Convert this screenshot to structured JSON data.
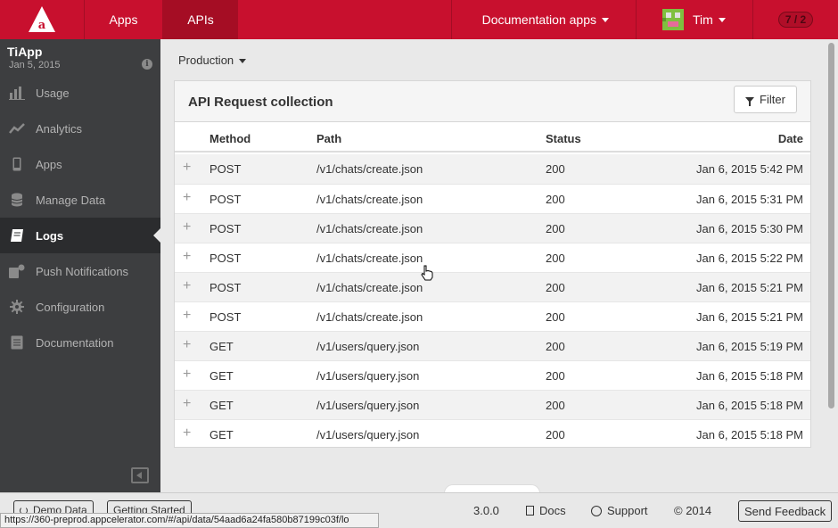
{
  "topnav": {
    "tabs": [
      {
        "label": "Apps"
      },
      {
        "label": "APIs"
      }
    ],
    "docs_dropdown": "Documentation apps",
    "user_name": "Tim",
    "badge": "7 / 2"
  },
  "sidebar": {
    "app_title": "TiApp",
    "app_date": "Jan 5, 2015",
    "items": [
      {
        "label": "Usage",
        "icon": "bar-chart-icon"
      },
      {
        "label": "Analytics",
        "icon": "line-chart-icon"
      },
      {
        "label": "Apps",
        "icon": "mobile-icon"
      },
      {
        "label": "Manage Data",
        "icon": "database-icon"
      },
      {
        "label": "Logs",
        "icon": "book-icon",
        "active": true
      },
      {
        "label": "Push Notifications",
        "icon": "push-icon"
      },
      {
        "label": "Configuration",
        "icon": "gear-icon"
      },
      {
        "label": "Documentation",
        "icon": "doc-icon"
      }
    ]
  },
  "main": {
    "environment": "Production",
    "panel_title": "API Request collection",
    "filter_label": "Filter",
    "columns": {
      "method": "Method",
      "path": "Path",
      "status": "Status",
      "date": "Date"
    },
    "rows": [
      {
        "method": "POST",
        "path": "/v1/chats/create.json",
        "status": "200",
        "date": "Jan 6, 2015 5:42 PM"
      },
      {
        "method": "POST",
        "path": "/v1/chats/create.json",
        "status": "200",
        "date": "Jan 6, 2015 5:31 PM"
      },
      {
        "method": "POST",
        "path": "/v1/chats/create.json",
        "status": "200",
        "date": "Jan 6, 2015 5:30 PM"
      },
      {
        "method": "POST",
        "path": "/v1/chats/create.json",
        "status": "200",
        "date": "Jan 6, 2015 5:22 PM"
      },
      {
        "method": "POST",
        "path": "/v1/chats/create.json",
        "status": "200",
        "date": "Jan 6, 2015 5:21 PM"
      },
      {
        "method": "POST",
        "path": "/v1/chats/create.json",
        "status": "200",
        "date": "Jan 6, 2015 5:21 PM"
      },
      {
        "method": "GET",
        "path": "/v1/users/query.json",
        "status": "200",
        "date": "Jan 6, 2015 5:19 PM"
      },
      {
        "method": "GET",
        "path": "/v1/users/query.json",
        "status": "200",
        "date": "Jan 6, 2015 5:18 PM"
      },
      {
        "method": "GET",
        "path": "/v1/users/query.json",
        "status": "200",
        "date": "Jan 6, 2015 5:18 PM"
      },
      {
        "method": "GET",
        "path": "/v1/users/query.json",
        "status": "200",
        "date": "Jan 6, 2015 5:18 PM"
      }
    ],
    "expand_symbol": "+"
  },
  "footer": {
    "demo_data": "Demo Data",
    "getting_started": "Getting Started",
    "version": "3.0.0",
    "docs": "Docs",
    "support": "Support",
    "copyright": "© 2014",
    "send_feedback": "Send Feedback"
  },
  "status_url": "https://360-preprod.appcelerator.com/#/api/data/54aad6a24fa580b87199c03f/lo",
  "colors": {
    "brand": "#c8102e",
    "sidebar": "#3d3e40"
  }
}
